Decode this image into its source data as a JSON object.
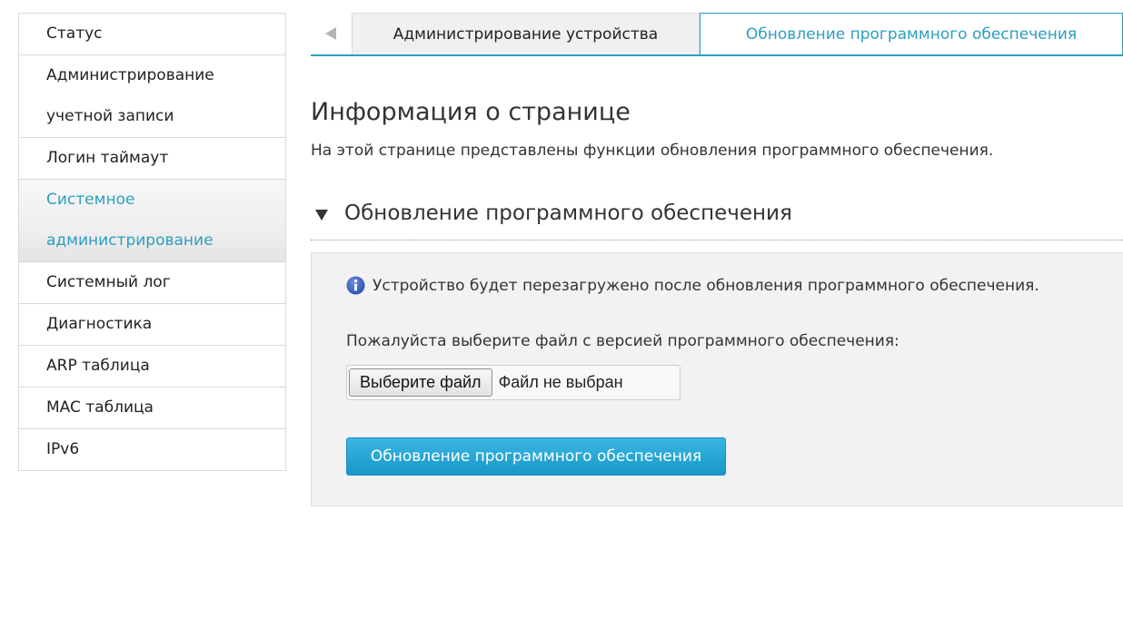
{
  "sidebar": {
    "items": [
      {
        "label": "Статус"
      },
      {
        "label_line1": "Администрирование",
        "label_line2": "учетной записи"
      },
      {
        "label": "Логин таймаут"
      },
      {
        "label_line1": "Системное",
        "label_line2": "администрирование"
      },
      {
        "label": "Системный лог"
      },
      {
        "label": "Диагностика"
      },
      {
        "label": "ARP таблица"
      },
      {
        "label": "MAC таблица"
      },
      {
        "label": "IPv6"
      }
    ],
    "active_index": 3
  },
  "tabs": {
    "back_icon": "triangle-left-icon",
    "items": [
      {
        "label": "Администрирование устройства",
        "active": false
      },
      {
        "label": "Обновление программного обеспечения",
        "active": true
      }
    ]
  },
  "page": {
    "title": "Информация о странице",
    "description": "На этой странице представлены функции обновления программного обеспечения."
  },
  "section": {
    "caret_icon": "triangle-down-icon",
    "title": "Обновление программного обеспечения",
    "notice_icon": "info-icon",
    "notice": "Устройство будет перезагружено после обновления программного обеспечения.",
    "file_label": "Пожалуйста выберите файл с версией программного обеспечения:",
    "file_button": "Выберите файл",
    "file_status": "Файл не выбран",
    "submit_button": "Обновление программного обеспечения"
  },
  "colors": {
    "accent": "#2a9fbf",
    "button": "#1fa5d4"
  }
}
